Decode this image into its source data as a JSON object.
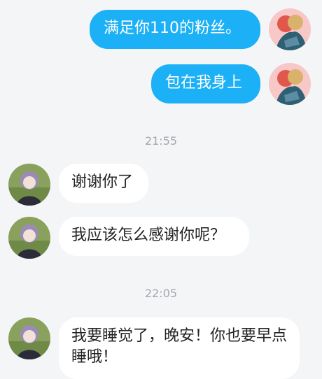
{
  "messages": [
    {
      "side": "out",
      "text": "满足你110的粉丝。",
      "avatar": "anime-couple-avatar"
    },
    {
      "side": "out",
      "text": "包在我身上",
      "avatar": "anime-couple-avatar"
    },
    {
      "type": "time",
      "text": "21:55"
    },
    {
      "side": "in",
      "text": "谢谢你了",
      "avatar": "purple-hair-boy-avatar"
    },
    {
      "side": "in",
      "text": "我应该怎么感谢你呢？",
      "avatar": "purple-hair-boy-avatar"
    },
    {
      "type": "time",
      "text": "22:05"
    },
    {
      "side": "in",
      "text": "我要睡觉了，晚安！你也要早点睡哦！",
      "avatar": "purple-hair-boy-avatar"
    }
  ],
  "colors": {
    "outgoing_bubble": "#1cb0f6",
    "incoming_bubble": "#ffffff",
    "background": "#f4f5f7",
    "timestamp": "#a3a7ad"
  }
}
